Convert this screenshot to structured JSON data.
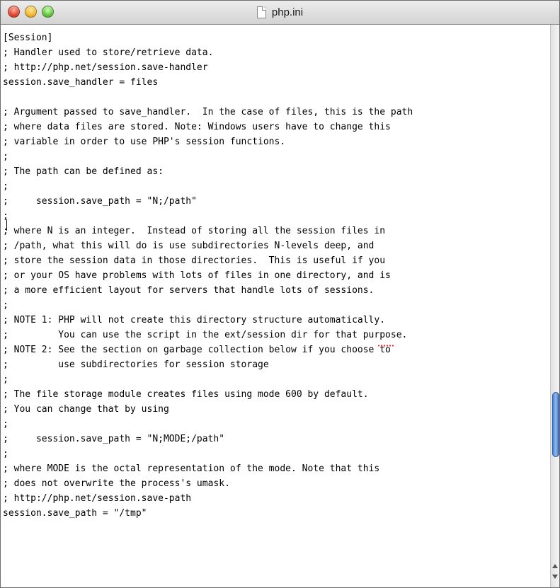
{
  "window": {
    "title": "php.ini"
  },
  "editor": {
    "lines": [
      "[Session]",
      "; Handler used to store/retrieve data.",
      "; http://php.net/session.save-handler",
      "session.save_handler = files",
      "",
      "; Argument passed to save_handler.  In the case of files, this is the path",
      "; where data files are stored. Note: Windows users have to change this",
      "; variable in order to use PHP's session functions.",
      ";",
      "; The path can be defined as:",
      ";",
      ";     session.save_path = \"N;/path\"",
      ";",
      "; where N is an integer.  Instead of storing all the session files in",
      "; /path, what this will do is use subdirectories N-levels deep, and",
      "; store the session data in those directories.  This is useful if you",
      "; or your OS have problems with lots of files in one directory, and is",
      "; a more efficient layout for servers that handle lots of sessions.",
      ";",
      "; NOTE 1: PHP will not create this directory structure automatically.",
      ";         You can use the script in the ext/session dir for that purpose.",
      "; NOTE 2: See the section on garbage collection below if you choose to",
      ";         use subdirectories for session storage",
      ";",
      "; The file storage module creates files using mode 600 by default.",
      "; You can change that by using",
      ";",
      ";     session.save_path = \"N;MODE;/path\"",
      ";",
      "; where MODE is the octal representation of the mode. Note that this",
      "; does not overwrite the process's umask.",
      "; http://php.net/session.save-path",
      "session.save_path = \"/tmp\""
    ]
  },
  "scrollbar": {
    "position": 0.62
  },
  "colors": {
    "spellcheck": "#e22222",
    "scroll_thumb": "#5b8fe0"
  }
}
